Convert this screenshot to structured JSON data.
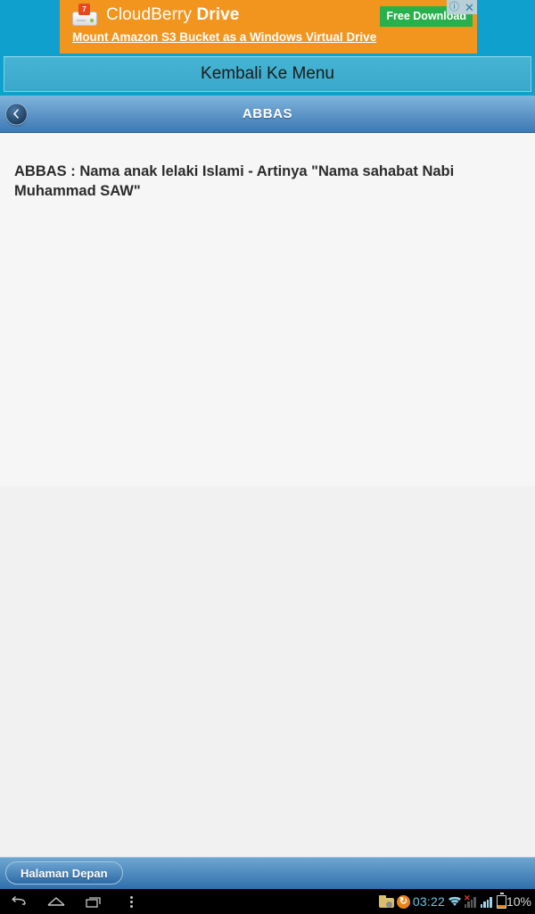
{
  "ad": {
    "brand_first": "CloudBerry",
    "brand_second": "Drive",
    "subtitle": "Mount Amazon S3 Bucket as a Windows Virtual Drive",
    "cta_label": "Free Download",
    "logo_badge": "7",
    "info_icon": "ⓘ",
    "close_icon": "✕",
    "bg_color": "#f2951e",
    "cta_color": "#28b04c"
  },
  "kembali": {
    "label": "Kembali Ke Menu"
  },
  "titlebar": {
    "title": "ABBAS",
    "back_icon": "chevron-left-icon"
  },
  "content": {
    "body_text": "ABBAS : Nama anak lelaki Islami - Artinya \"Nama sahabat Nabi Muhammad SAW\""
  },
  "bottom": {
    "home_label": "Halaman Depan"
  },
  "system": {
    "nav": {
      "back": "back-icon",
      "home": "home-icon",
      "recents": "recents-icon",
      "menu": "overflow-menu-icon"
    },
    "status": {
      "folder": "folder-icon",
      "sync": "sync-icon",
      "time": "03:22",
      "wifi": "wifi-icon",
      "signal_1": "signal-no-service-icon",
      "signal_2": "signal-icon",
      "battery": "battery-icon",
      "battery_text": "10%"
    }
  }
}
